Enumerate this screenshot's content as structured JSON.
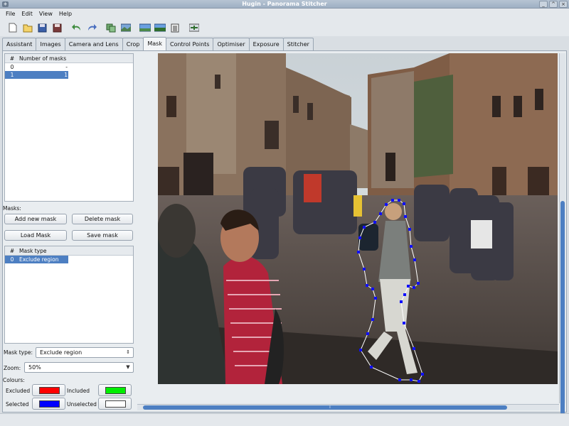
{
  "window": {
    "title": "Hugin - Panorama Stitcher"
  },
  "menu": [
    "File",
    "Edit",
    "View",
    "Help"
  ],
  "tabs": [
    "Assistant",
    "Images",
    "Camera and Lens",
    "Crop",
    "Mask",
    "Control Points",
    "Optimiser",
    "Exposure",
    "Stitcher"
  ],
  "active_tab": "Mask",
  "images_list": {
    "headers": [
      "#",
      "Number of masks"
    ],
    "rows": [
      {
        "index": "0",
        "masks": "-"
      },
      {
        "index": "1",
        "masks": "1",
        "selected": true
      }
    ]
  },
  "masks": {
    "label": "Masks:",
    "add_label": "Add new mask",
    "delete_label": "Delete mask",
    "load_label": "Load Mask",
    "save_label": "Save mask",
    "headers": [
      "#",
      "Mask type"
    ],
    "rows": [
      {
        "index": "0",
        "type": "Exclude region",
        "selected": true
      }
    ]
  },
  "mask_type": {
    "label": "Mask type:",
    "value": "Exclude region"
  },
  "zoom": {
    "label": "Zoom:",
    "value": "50%"
  },
  "colours": {
    "label": "Colours:",
    "excluded_label": "Excluded",
    "excluded_color": "#ff0000",
    "included_label": "Included",
    "included_color": "#00ee00",
    "selected_label": "Selected",
    "selected_color": "#0000ff",
    "unselected_label": "Unselected",
    "unselected_color": "#ffffff"
  },
  "toolbar_icons": [
    "new-document-icon",
    "open-folder-icon",
    "save-icon",
    "save-as-icon",
    "undo-icon",
    "redo-icon",
    "add-images-icon",
    "align-icon",
    "preview-icon",
    "fast-preview-icon",
    "control-points-icon",
    "optimize-icon"
  ],
  "accent_color": "#4d7fc2"
}
